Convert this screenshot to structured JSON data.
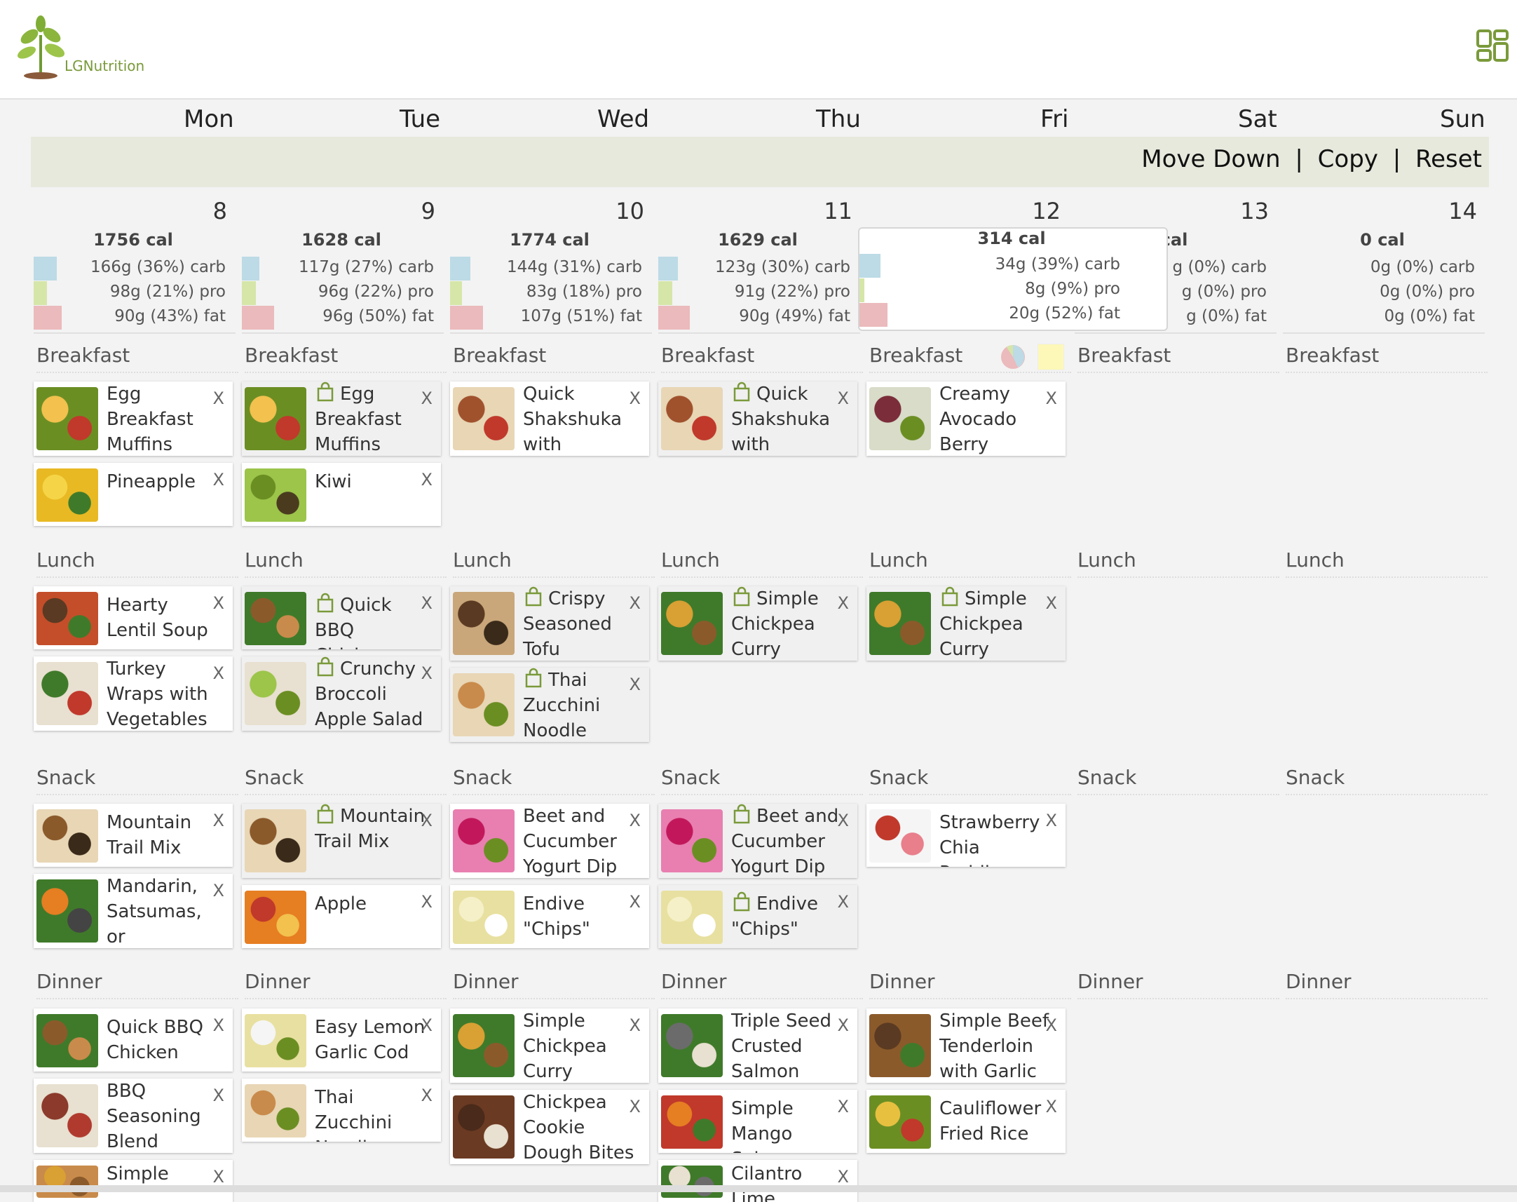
{
  "brand": {
    "name": "LGNutrition",
    "accent": "#7a9a3a"
  },
  "header": {
    "menu_icon": "grid-icon"
  },
  "week": {
    "days": [
      "Mon",
      "Tue",
      "Wed",
      "Thu",
      "Fri",
      "Sat",
      "Sun"
    ],
    "dates": [
      "8",
      "9",
      "10",
      "11",
      "12",
      "13",
      "14"
    ]
  },
  "actions": {
    "move_down": "Move Down",
    "copy": "Copy",
    "reset": "Reset",
    "sep": "|"
  },
  "summaries": [
    {
      "cal": "1756 cal",
      "carb": "166g (36%) carb",
      "pro": "98g (21%) pro",
      "fat": "90g (43%) fat",
      "carb_pct": 36,
      "pro_pct": 21,
      "fat_pct": 43
    },
    {
      "cal": "1628 cal",
      "carb": "117g (27%) carb",
      "pro": "96g (22%) pro",
      "fat": "96g (50%) fat",
      "carb_pct": 27,
      "pro_pct": 22,
      "fat_pct": 50
    },
    {
      "cal": "1774 cal",
      "carb": "144g (31%) carb",
      "pro": "83g (18%) pro",
      "fat": "107g (51%) fat",
      "carb_pct": 31,
      "pro_pct": 18,
      "fat_pct": 51
    },
    {
      "cal": "1629 cal",
      "carb": "123g (30%) carb",
      "pro": "91g (22%) pro",
      "fat": "90g (49%) fat",
      "carb_pct": 30,
      "pro_pct": 22,
      "fat_pct": 49
    },
    {
      "cal": "314 cal",
      "carb": "34g (39%) carb",
      "pro": "8g (9%) pro",
      "fat": "20g (52%) fat",
      "carb_pct": 39,
      "pro_pct": 9,
      "fat_pct": 52
    },
    {
      "cal": "cal",
      "carb": "g (0%) carb",
      "pro": "g (0%) pro",
      "fat": "g (0%) fat",
      "carb_pct": 0,
      "pro_pct": 0,
      "fat_pct": 0
    },
    {
      "cal": "0 cal",
      "carb": "0g (0%) carb",
      "pro": "0g (0%) pro",
      "fat": "0g (0%) fat",
      "carb_pct": 0,
      "pro_pct": 0,
      "fat_pct": 0
    }
  ],
  "macro_colors": {
    "carb": "#bcdbe6",
    "pro": "#d5e6a8",
    "fat": "#ebbabc"
  },
  "meal_labels": {
    "breakfast": "Breakfast",
    "lunch": "Lunch",
    "snack": "Snack",
    "dinner": "Dinner"
  },
  "cards": {
    "mon_b1": "Egg Breakfast Muffins",
    "mon_b2": "Pineapple",
    "tue_b1": "Egg Breakfast Muffins",
    "tue_b2": "Kiwi",
    "wed_b1": "Quick Shakshuka with Collards",
    "thu_b1": "Quick Shakshuka with Collards",
    "fri_b1": "Creamy Avocado Berry",
    "mon_l1": "Hearty Lentil Soup",
    "mon_l2": "Turkey Wraps with Vegetables",
    "tue_l1": "Quick BBQ Chicken",
    "tue_l2": "Crunchy Broccoli Apple Salad",
    "wed_l1": "Crispy Seasoned Tofu",
    "wed_l2": "Thai Zucchini Noodle Bowl",
    "thu_l1": "Simple Chickpea Curry",
    "fri_l1": "Simple Chickpea Curry",
    "mon_s1": "Mountain Trail Mix",
    "mon_s2": "Mandarin, Satsumas, or Clementines",
    "tue_s1": "Mountain Trail Mix",
    "tue_s2": "Apple",
    "wed_s1": "Beet and Cucumber Yogurt Dip",
    "wed_s2": "Endive \"Chips\"",
    "thu_s1": "Beet and Cucumber Yogurt Dip",
    "thu_s2": "Endive \"Chips\"",
    "fri_s1": "Strawberry Chia Pudding",
    "mon_d1": "Quick BBQ Chicken",
    "mon_d2": "BBQ Seasoning Blend",
    "mon_d3": "Simple",
    "tue_d1": "Easy Lemon Garlic Cod",
    "tue_d2": "Thai Zucchini Noodle Bowl",
    "wed_d1": "Simple Chickpea Curry",
    "wed_d2": "Chickpea Cookie Dough Bites",
    "thu_d1": "Triple Seed Crusted Salmon",
    "thu_d2": "Simple Mango Salsa",
    "thu_d3": "Cilantro Lime",
    "fri_d1": "Simple Beef Tenderloin with Garlic",
    "fri_d2": "Cauliflower Fried Rice"
  },
  "close_label": "X"
}
